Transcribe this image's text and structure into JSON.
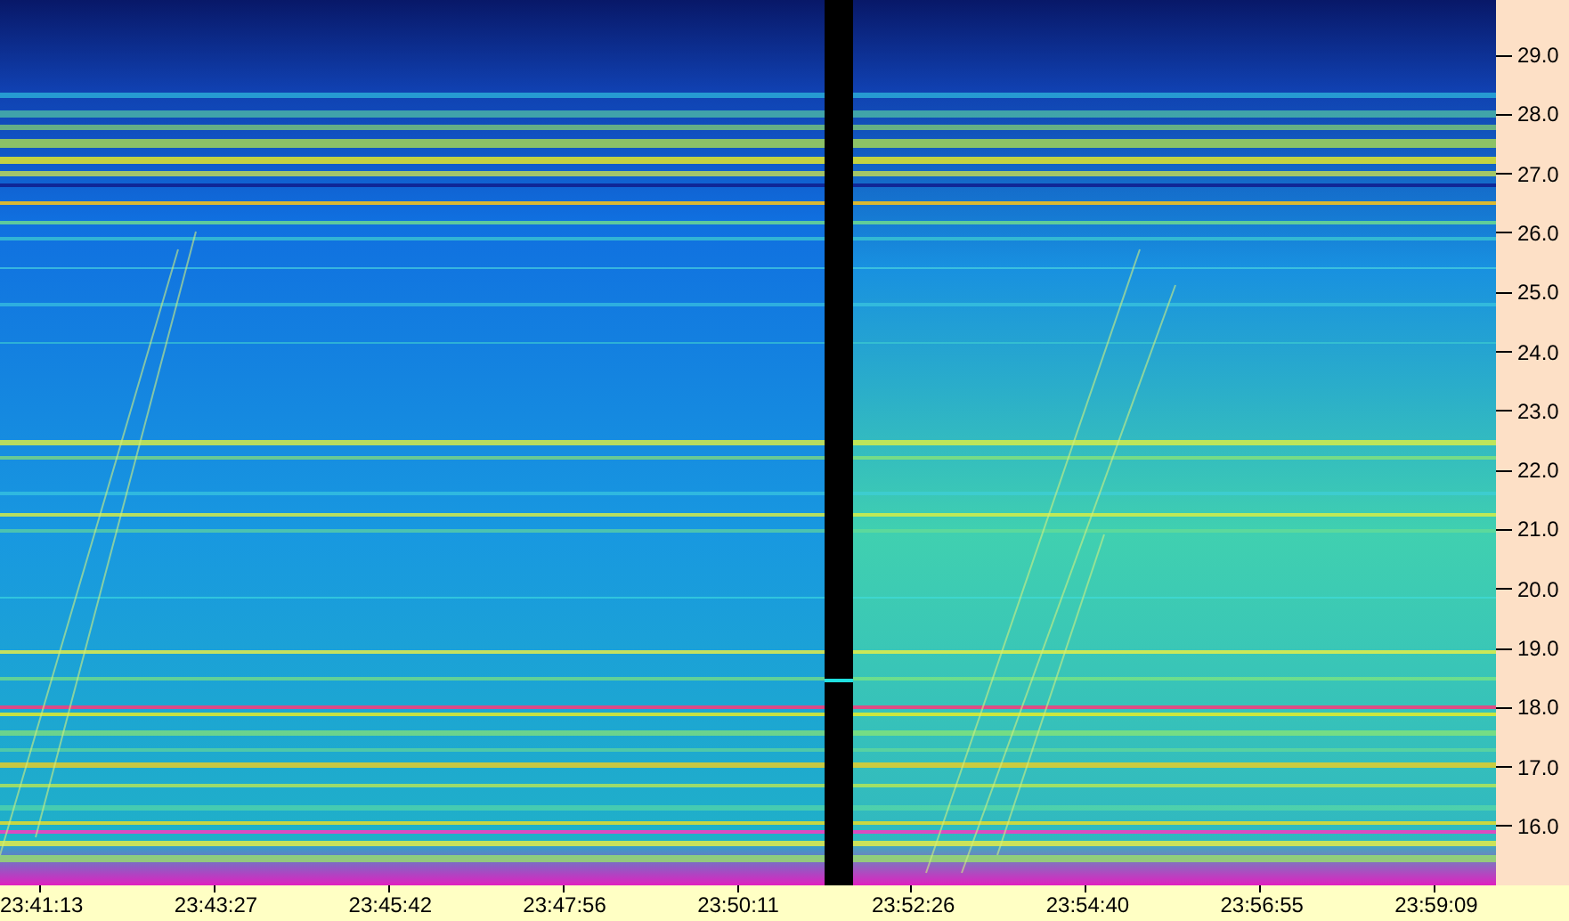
{
  "y_axis": {
    "ticks": [
      "29.0",
      "28.0",
      "27.0",
      "26.0",
      "25.0",
      "24.0",
      "23.0",
      "22.0",
      "21.0",
      "20.0",
      "19.0",
      "18.0",
      "17.0",
      "16.0"
    ]
  },
  "x_axis": {
    "ticks": [
      "23:41:13",
      "23:43:27",
      "23:45:42",
      "23:47:56",
      "23:50:11",
      "23:52:26",
      "23:54:40",
      "23:56:55",
      "23:59:09"
    ]
  }
}
